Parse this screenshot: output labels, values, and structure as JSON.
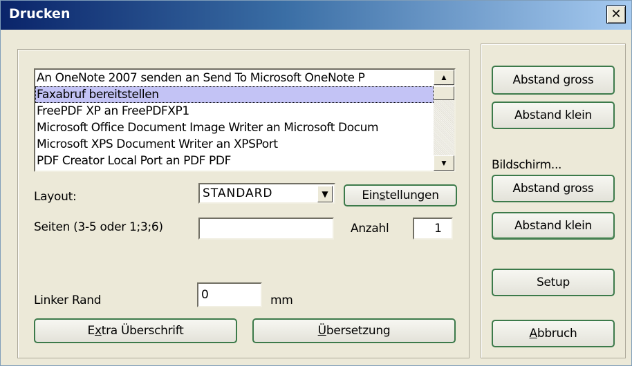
{
  "window": {
    "title": "Drucken",
    "close_label": "✕"
  },
  "printers": {
    "items": [
      "An OneNote 2007 senden an Send To Microsoft OneNote P",
      "Faxabruf bereitstellen",
      "FreePDF XP an FreePDFXP1",
      "Microsoft Office Document Image Writer an Microsoft Docum",
      "Microsoft XPS Document Writer an XPSPort",
      "PDF Creator Local Port an PDF PDF"
    ],
    "selected_index": 1
  },
  "layout": {
    "label": "Layout:",
    "value": "STANDARD",
    "settings_button": {
      "pre": "Ein",
      "ul": "s",
      "post": "tellungen"
    }
  },
  "pages": {
    "label": "Seiten (3-5 oder 1;3;6)",
    "value": "",
    "count_label": "Anzahl",
    "count_value": "1"
  },
  "margin": {
    "label": "Linker Rand",
    "value": "0",
    "unit": "mm"
  },
  "extra_heading_button": {
    "pre": "E",
    "ul": "x",
    "post": "tra Überschrift"
  },
  "translation_button": {
    "pre": "",
    "ul": "Ü",
    "post": "bersetzung"
  },
  "side": {
    "print_gap_large": "Abstand gross",
    "print_gap_small": "Abstand klein",
    "screen_label": "Bildschirm...",
    "screen_gap_large": "Abstand gross",
    "screen_gap_small": "Abstand klein",
    "setup": "Setup",
    "cancel": {
      "pre": "",
      "ul": "A",
      "post": "bbruch"
    }
  },
  "icons": {
    "scroll_up": "▲",
    "scroll_down": "▼",
    "combo_arrow": "▼"
  }
}
